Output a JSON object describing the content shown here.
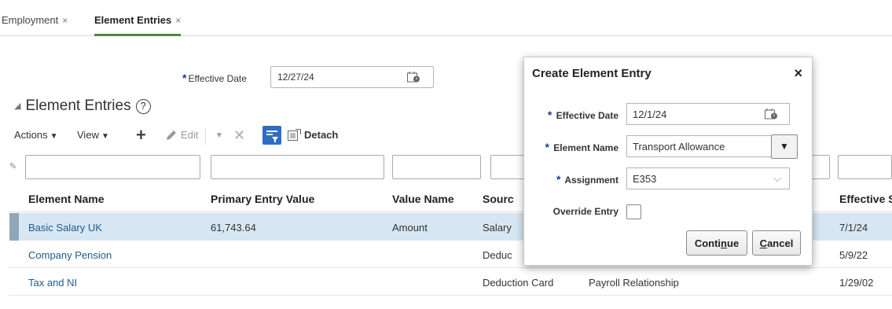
{
  "tabs": [
    {
      "label": "Employment",
      "close": "×"
    },
    {
      "label": "Element Entries",
      "close": "×"
    }
  ],
  "effective_date": {
    "required": "*",
    "label": "Effective Date",
    "value": "12/27/24"
  },
  "section": {
    "title": "Element Entries",
    "help": "?"
  },
  "toolbar": {
    "actions": "Actions",
    "view": "View",
    "edit": "Edit",
    "detach": "Detach",
    "caret": "▼",
    "plus": "+",
    "delete": "✕"
  },
  "table": {
    "columns": [
      "Element Name",
      "Primary Entry Value",
      "Value Name",
      "Sourc",
      "Effective S"
    ],
    "rows": [
      {
        "element_name": "Basic Salary UK",
        "primary_value": "61,743.64",
        "value_name": "Amount",
        "source": "Salary",
        "relationship": "",
        "effective": "7/1/24"
      },
      {
        "element_name": "Company Pension",
        "primary_value": "",
        "value_name": "",
        "source": "Deduc",
        "relationship": "",
        "effective": "5/9/22"
      },
      {
        "element_name": "Tax and NI",
        "primary_value": "",
        "value_name": "",
        "source": "Deduction Card",
        "relationship": "Payroll Relationship",
        "effective": "1/29/02"
      }
    ]
  },
  "dialog": {
    "title": "Create Element Entry",
    "close": "×",
    "effective_date_label": "Effective Date",
    "effective_date_value": "12/1/24",
    "element_name_label": "Element Name",
    "element_name_value": "Transport Allowance",
    "assignment_label": "Assignment",
    "assignment_value": "E353",
    "override_label": "Override Entry",
    "continue_pre": "Conti",
    "continue_u": "n",
    "continue_post": "ue",
    "cancel_u": "C",
    "cancel_post": "ancel",
    "required": "*",
    "chev": "⌵",
    "select_arrow": "▼"
  },
  "colors": {
    "accent": "#2e6dc4",
    "link": "#215c8e",
    "selected_row": "#d6e6f2",
    "required": "#1a3f8f"
  }
}
